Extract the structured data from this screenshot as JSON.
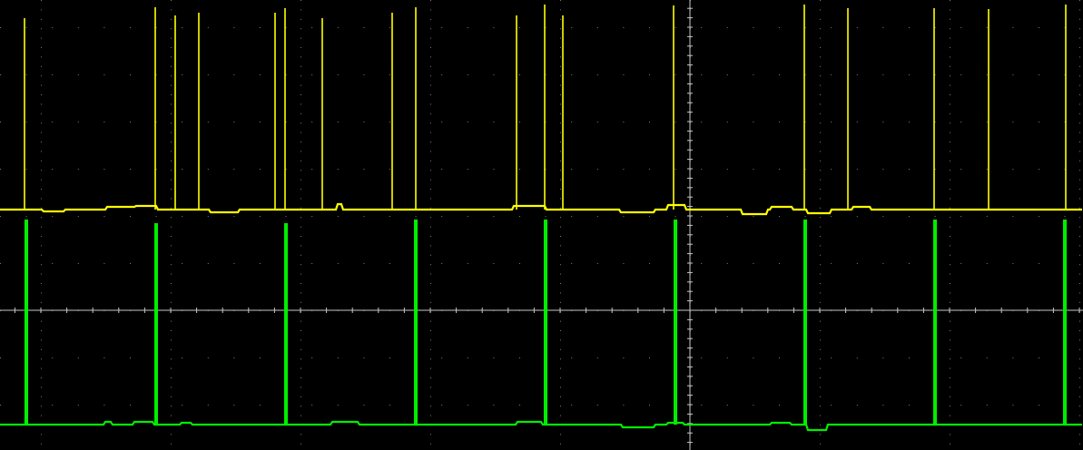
{
  "chart_data": {
    "type": "line",
    "title": "",
    "xlabel": "",
    "ylabel": "",
    "grid": true,
    "grid_divisions": {
      "x": 14,
      "y": 8
    },
    "x_range": [
      0,
      1193
    ],
    "series": [
      {
        "color": "#ffff00",
        "baseline": 231,
        "noise_dips": [
          [
            48,
            70,
            233
          ],
          [
            118,
            150,
            228
          ],
          [
            150,
            172,
            227
          ],
          [
            232,
            262,
            234
          ],
          [
            372,
            376,
            225
          ],
          [
            565,
            600,
            227
          ],
          [
            684,
            720,
            234
          ],
          [
            736,
            754,
            226
          ],
          [
            818,
            845,
            236
          ],
          [
            850,
            872,
            228
          ],
          [
            890,
            915,
            235
          ],
          [
            940,
            958,
            228
          ]
        ],
        "spikes": [
          {
            "x": 27,
            "top": 20
          },
          {
            "x": 171,
            "top": 8
          },
          {
            "x": 193,
            "top": 17
          },
          {
            "x": 219,
            "top": 14
          },
          {
            "x": 303,
            "top": 14
          },
          {
            "x": 314,
            "top": 9
          },
          {
            "x": 355,
            "top": 20
          },
          {
            "x": 432,
            "top": 14
          },
          {
            "x": 458,
            "top": 8
          },
          {
            "x": 569,
            "top": 17
          },
          {
            "x": 600,
            "top": 5
          },
          {
            "x": 620,
            "top": 17
          },
          {
            "x": 742,
            "top": 6
          },
          {
            "x": 886,
            "top": 5
          },
          {
            "x": 934,
            "top": 9
          },
          {
            "x": 1029,
            "top": 9
          },
          {
            "x": 1089,
            "top": 10
          },
          {
            "x": 1174,
            "top": 5
          }
        ]
      },
      {
        "color": "#00ee00",
        "baseline": 468,
        "noise_dips": [
          [
            116,
            122,
            465
          ],
          [
            148,
            168,
            465
          ],
          [
            200,
            210,
            466
          ],
          [
            365,
            395,
            465
          ],
          [
            570,
            596,
            465
          ],
          [
            686,
            720,
            471
          ],
          [
            736,
            752,
            466
          ],
          [
            850,
            870,
            466
          ],
          [
            890,
            910,
            474
          ]
        ],
        "pulses": [
          {
            "x": 29,
            "top": 242
          },
          {
            "x": 172,
            "top": 246
          },
          {
            "x": 315,
            "top": 246
          },
          {
            "x": 458,
            "top": 242
          },
          {
            "x": 601,
            "top": 242
          },
          {
            "x": 744,
            "top": 242
          },
          {
            "x": 887,
            "top": 242
          },
          {
            "x": 1030,
            "top": 242
          },
          {
            "x": 1173,
            "top": 242
          }
        ]
      }
    ]
  }
}
